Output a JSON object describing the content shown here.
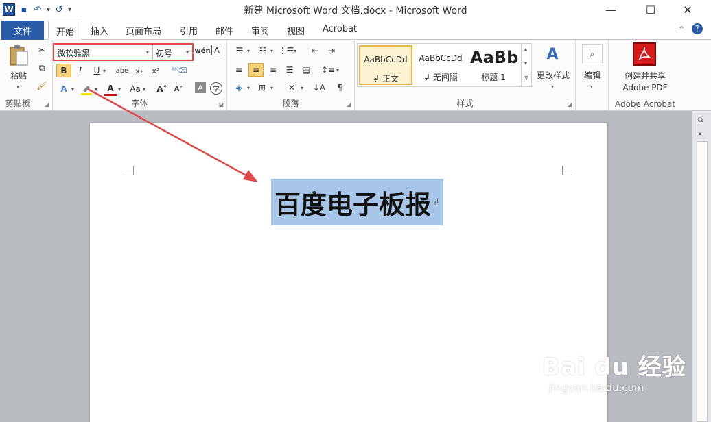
{
  "window": {
    "title": "新建 Microsoft Word 文档.docx - Microsoft Word",
    "minimize": "—",
    "maximize": "☐",
    "close": "✕"
  },
  "qat": {
    "logo": "W",
    "save": "▪",
    "undo": "↶",
    "redo": "↺",
    "customize": "▾"
  },
  "tabs": {
    "file": "文件",
    "items": [
      "开始",
      "插入",
      "页面布局",
      "引用",
      "邮件",
      "审阅",
      "视图",
      "Acrobat"
    ],
    "active": "开始",
    "collapse": "⌃",
    "help": "?"
  },
  "clipboard": {
    "paste": "粘贴",
    "cut_icon": "scissors-icon",
    "label": "剪贴板"
  },
  "font": {
    "name": "微软雅黑",
    "size": "初号",
    "bold": "B",
    "italic": "I",
    "underline": "U",
    "strike": "abe",
    "subscript": "x₂",
    "superscript": "x²",
    "grow": "A˄",
    "shrink": "A˅",
    "change_case": "Aa",
    "label": "字体"
  },
  "paragraph": {
    "label": "段落"
  },
  "styles": {
    "items": [
      {
        "sample": "AaBbCcDd",
        "name": "↲ 正文"
      },
      {
        "sample": "AaBbCcDd",
        "name": "↲ 无间隔"
      },
      {
        "sample": "AaBb",
        "name": "标题 1"
      }
    ],
    "change": "更改样式",
    "label": "样式"
  },
  "editing": {
    "label": "编辑"
  },
  "acrobat": {
    "create_line1": "创建并共享",
    "create_line2": "Adobe PDF",
    "label": "Adobe Acrobat"
  },
  "document": {
    "heading": "百度电子板报",
    "para_mark": "↲"
  },
  "watermark": {
    "main": "Bai du 经验",
    "sub": "jingyan.baidu.com"
  },
  "colors": {
    "accent": "#2a5ba8",
    "highlight": "#a7c6e8",
    "annotation": "#e04848"
  }
}
